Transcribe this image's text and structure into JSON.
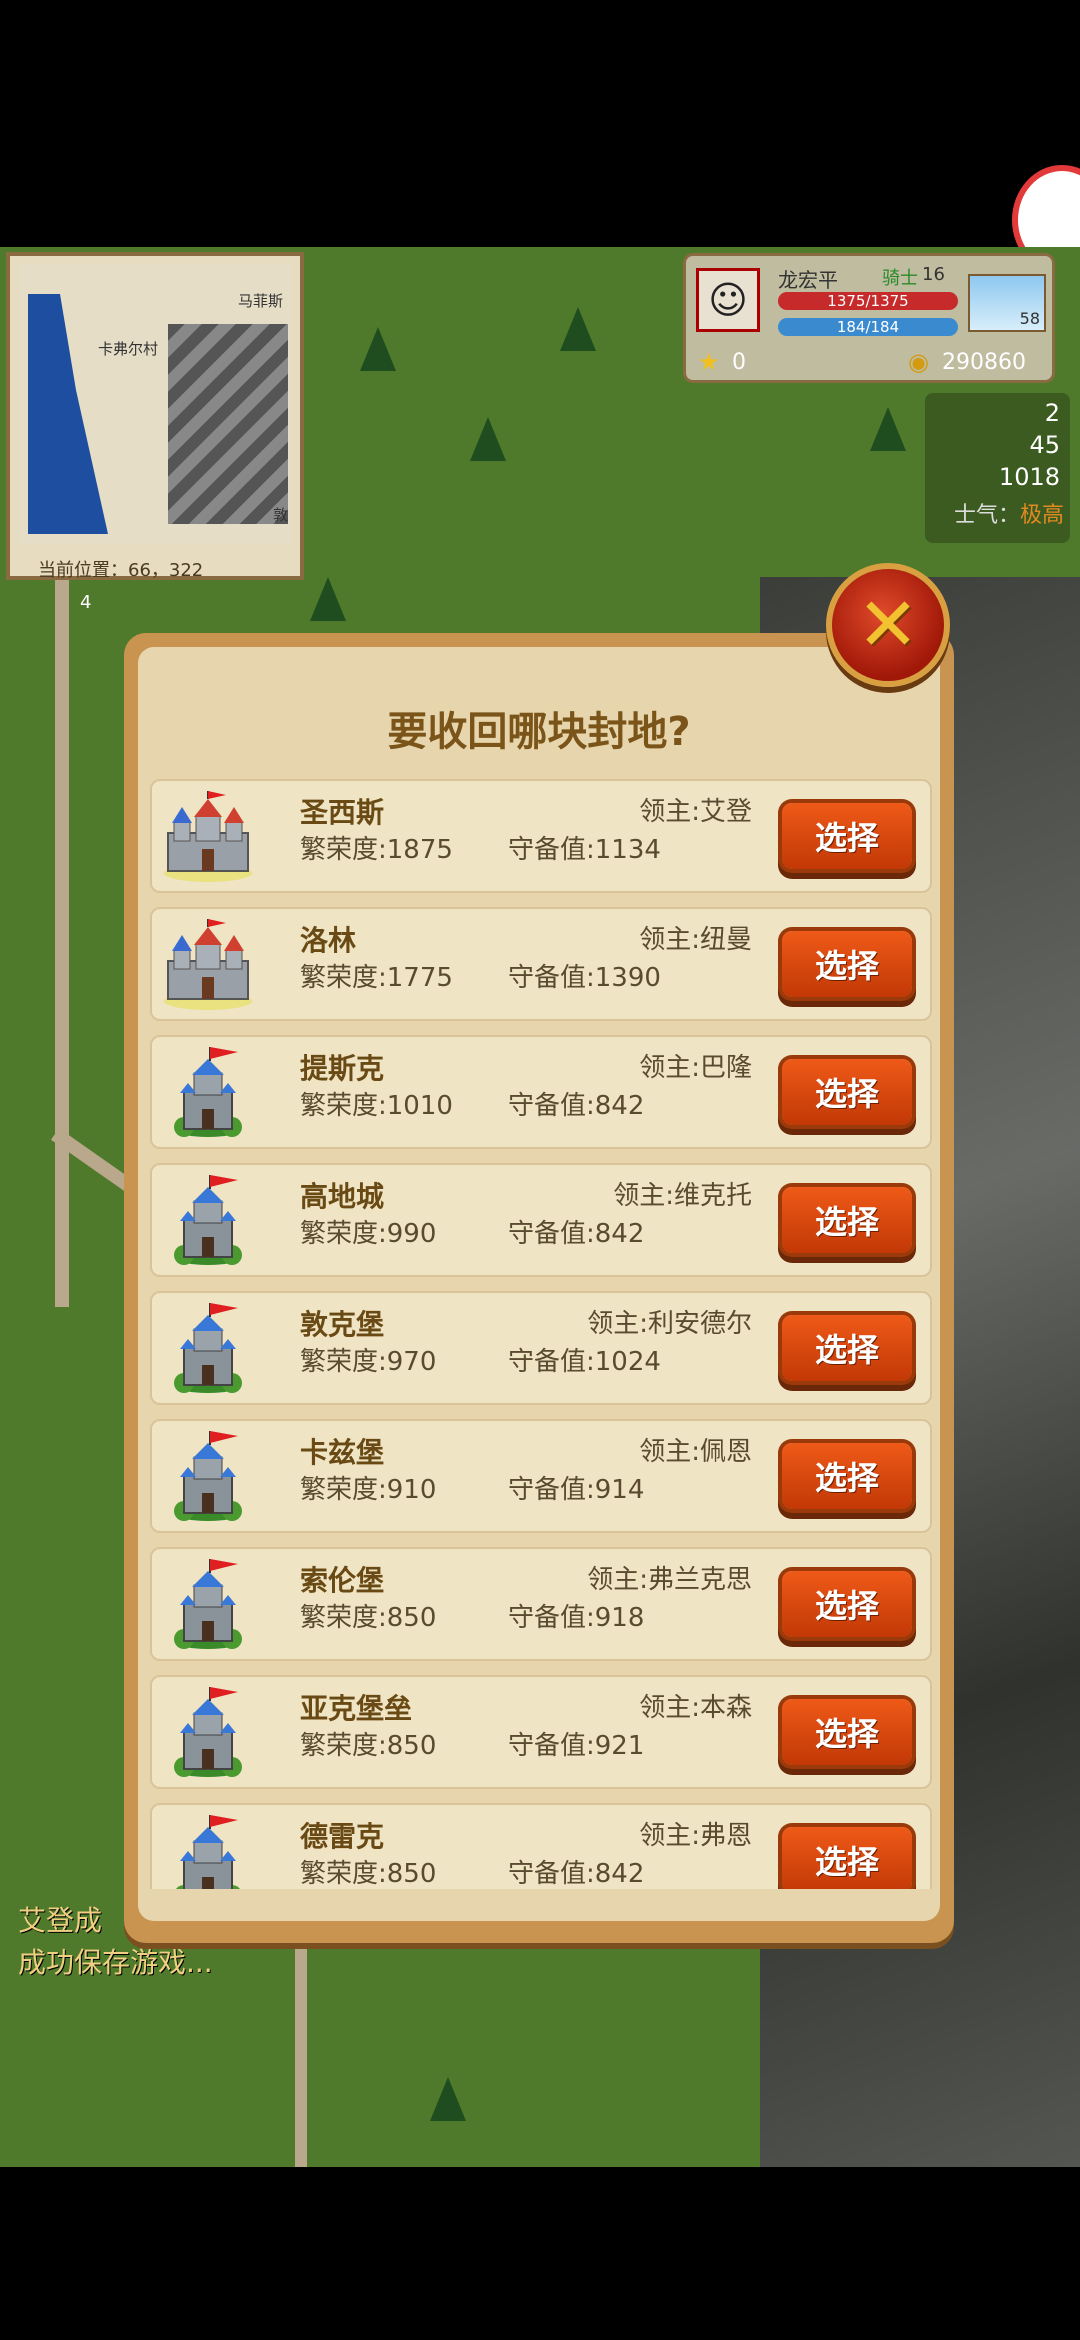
{
  "minimap": {
    "label_left": "卡弗尔村",
    "label_right": "马菲斯",
    "label_side": "敦",
    "position_label": "当前位置：",
    "position_value": "66，322",
    "number_marker": "4"
  },
  "hud": {
    "player_name": "龙宏平",
    "role": "骑士",
    "level": "16",
    "hp": "1375/1375",
    "mp": "184/184",
    "weather_value": "58",
    "stars": "0",
    "gold": "290860"
  },
  "resources": {
    "r1": "2",
    "r2": "45",
    "r3": "1018",
    "morale_label": "士气：",
    "morale_value": "极高"
  },
  "log": {
    "line1": "艾登成",
    "line2": "成功保存游戏..."
  },
  "dialog": {
    "title": "要收回哪块封地?",
    "button_label": "选择",
    "fiefs": [
      {
        "name": "圣西斯",
        "lord": "领主:艾登",
        "prosperity": "繁荣度:1875",
        "defense": "守备值:1134",
        "icon": "castle-large-icon"
      },
      {
        "name": "洛林",
        "lord": "领主:纽曼",
        "prosperity": "繁荣度:1775",
        "defense": "守备值:1390",
        "icon": "castle-large-icon"
      },
      {
        "name": "提斯克",
        "lord": "领主:巴隆",
        "prosperity": "繁荣度:1010",
        "defense": "守备值:842",
        "icon": "castle-tower-icon"
      },
      {
        "name": "高地城",
        "lord": "领主:维克托",
        "prosperity": "繁荣度:990",
        "defense": "守备值:842",
        "icon": "castle-tower-icon"
      },
      {
        "name": "敦克堡",
        "lord": "领主:利安德尔",
        "prosperity": "繁荣度:970",
        "defense": "守备值:1024",
        "icon": "castle-tower-icon"
      },
      {
        "name": "卡兹堡",
        "lord": "领主:佩恩",
        "prosperity": "繁荣度:910",
        "defense": "守备值:914",
        "icon": "castle-tower-icon"
      },
      {
        "name": "索伦堡",
        "lord": "领主:弗兰克思",
        "prosperity": "繁荣度:850",
        "defense": "守备值:918",
        "icon": "castle-tower-icon"
      },
      {
        "name": "亚克堡垒",
        "lord": "领主:本森",
        "prosperity": "繁荣度:850",
        "defense": "守备值:921",
        "icon": "castle-tower-icon"
      },
      {
        "name": "德雷克",
        "lord": "领主:弗恩",
        "prosperity": "繁荣度:850",
        "defense": "守备值:842",
        "icon": "castle-tower-icon"
      }
    ]
  }
}
